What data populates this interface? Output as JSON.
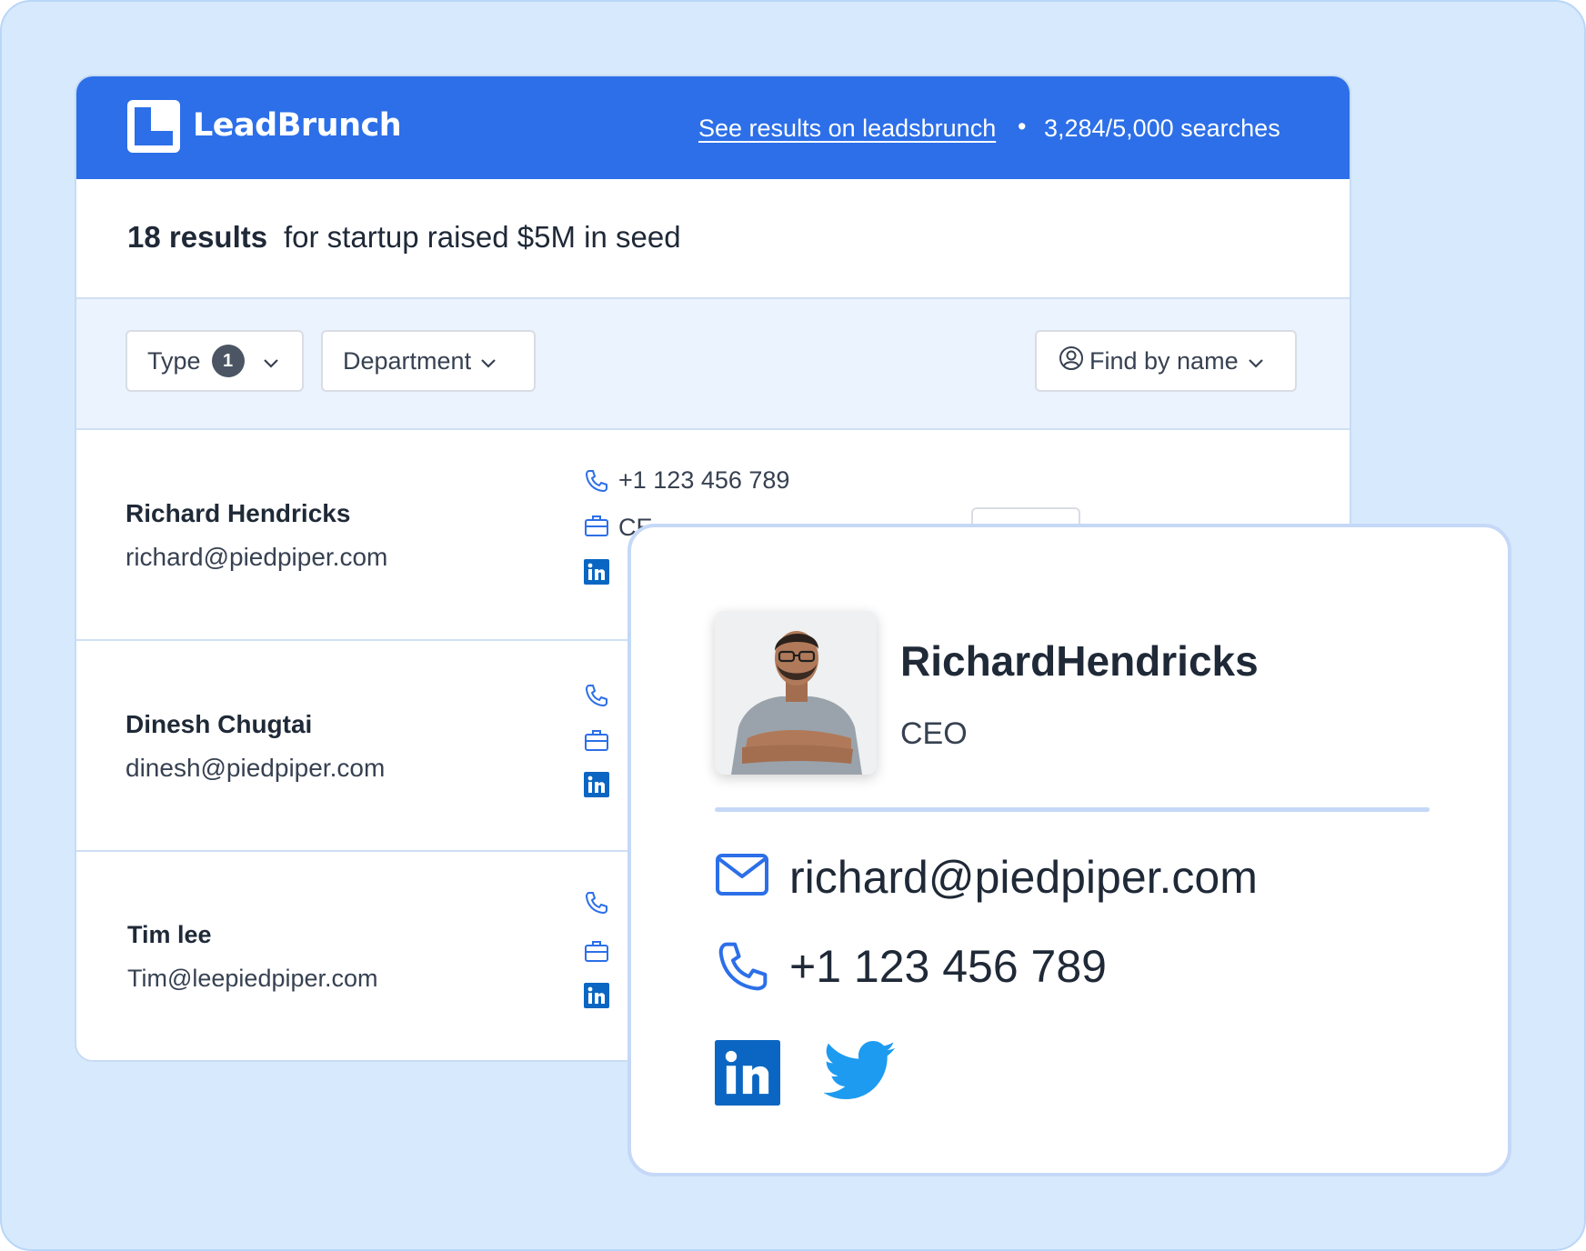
{
  "header": {
    "brand": "LeadBrunch",
    "see_results_link": "See results on leadsbrunch",
    "separator": "•",
    "searches": "3,284/5,000 searches"
  },
  "results": {
    "count": "18 results",
    "query": "for startup raised $5M in seed"
  },
  "filters": {
    "type_label": "Type",
    "type_count": "1",
    "department_label": "Department",
    "find_by_name_label": "Find by name"
  },
  "rows": [
    {
      "name": "Richard Hendricks",
      "email": "richard@piedpiper.com",
      "phone": "+1 123 456 789",
      "title": "CE"
    },
    {
      "name": "Dinesh Chugtai",
      "email": "dinesh@piedpiper.com"
    },
    {
      "name": "Tim lee",
      "email": "Tim@leepiedpiper.com"
    }
  ],
  "card": {
    "name": "RichardHendricks",
    "title": "CEO",
    "email": "richard@piedpiper.com",
    "phone": "+1 123 456 789"
  },
  "colors": {
    "brand_blue": "#2c6fe8",
    "background": "#d7e9fd",
    "filter_bar": "#eaf3fe",
    "linkedin_blue": "#0a66c2",
    "twitter_blue": "#1d9bf0"
  },
  "icons": [
    "logo-icon",
    "chevron-down-icon",
    "user-circle-icon",
    "phone-icon",
    "briefcase-icon",
    "linkedin-icon",
    "mail-icon",
    "twitter-icon"
  ]
}
